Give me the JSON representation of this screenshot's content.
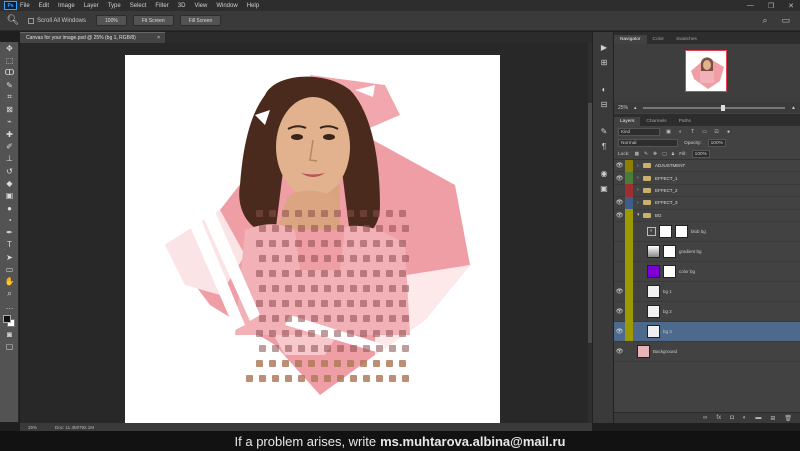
{
  "app": {
    "logo": "Ps"
  },
  "menu": [
    "File",
    "Edit",
    "Image",
    "Layer",
    "Type",
    "Select",
    "Filter",
    "3D",
    "View",
    "Window",
    "Help"
  ],
  "window_controls": {
    "minimize": "—",
    "maximize": "❐",
    "close": "✕"
  },
  "options_bar": {
    "tool_icon": "zoom-icon",
    "scroll_all_windows": "Scroll All Windows",
    "buttons": [
      "100%",
      "Fit Screen",
      "Fill Screen"
    ]
  },
  "document": {
    "tab_title": "Canvas for your image.psd @ 25% (bg 1, RGB/8)",
    "close": "×"
  },
  "status_bar": {
    "zoom": "25%",
    "doc_size": "Doc: 11.3M/792.1M"
  },
  "navigator": {
    "tabs": [
      "Navigator",
      "Color",
      "Swatches"
    ],
    "zoom": "25%"
  },
  "layers_panel": {
    "tabs": [
      "Layers",
      "Channels",
      "Paths"
    ],
    "kind": "Kind",
    "blend_mode": "Normal",
    "opacity_label": "Opacity:",
    "opacity": "100%",
    "lock_label": "Lock:",
    "fill_label": "Fill:",
    "fill": "100%",
    "layers": [
      {
        "name": "ADJUSTMENT",
        "type": "group",
        "tag": "#8b8000",
        "eye": true
      },
      {
        "name": "EFFECT_1",
        "type": "group",
        "tag": "#4b7d3a",
        "eye": true
      },
      {
        "name": "EFFECT_2",
        "type": "group",
        "tag": "#9c2f2f",
        "eye": false
      },
      {
        "name": "EFFECT_3",
        "type": "group",
        "tag": "#3c5f8a",
        "eye": true
      },
      {
        "name": "BG",
        "type": "group-open",
        "tag": "#9c9a00",
        "eye": true
      },
      {
        "name": "blob bg",
        "type": "adjustment",
        "tag": "#9c9a00",
        "eye": false,
        "thumb": "mask"
      },
      {
        "name": "gradient bg",
        "type": "layer",
        "tag": "#9c9a00",
        "eye": false,
        "thumb": "grad"
      },
      {
        "name": "color bg",
        "type": "layer",
        "tag": "#9c9a00",
        "eye": false,
        "thumb": "purple"
      },
      {
        "name": "bg 1",
        "type": "layer",
        "tag": "#9c9a00",
        "eye": true,
        "thumb": "white"
      },
      {
        "name": "bg 2",
        "type": "layer",
        "tag": "#9c9a00",
        "eye": true,
        "thumb": "white"
      },
      {
        "name": "bg 3",
        "type": "layer",
        "tag": "#9c9a00",
        "eye": true,
        "thumb": "white",
        "selected": true
      },
      {
        "name": "Background",
        "type": "background",
        "tag": "#424242",
        "eye": true,
        "thumb": "photo"
      }
    ]
  },
  "subtitle": {
    "text": "If a problem arises, write",
    "email": "ms.muhtarova.albina@mail.ru"
  }
}
